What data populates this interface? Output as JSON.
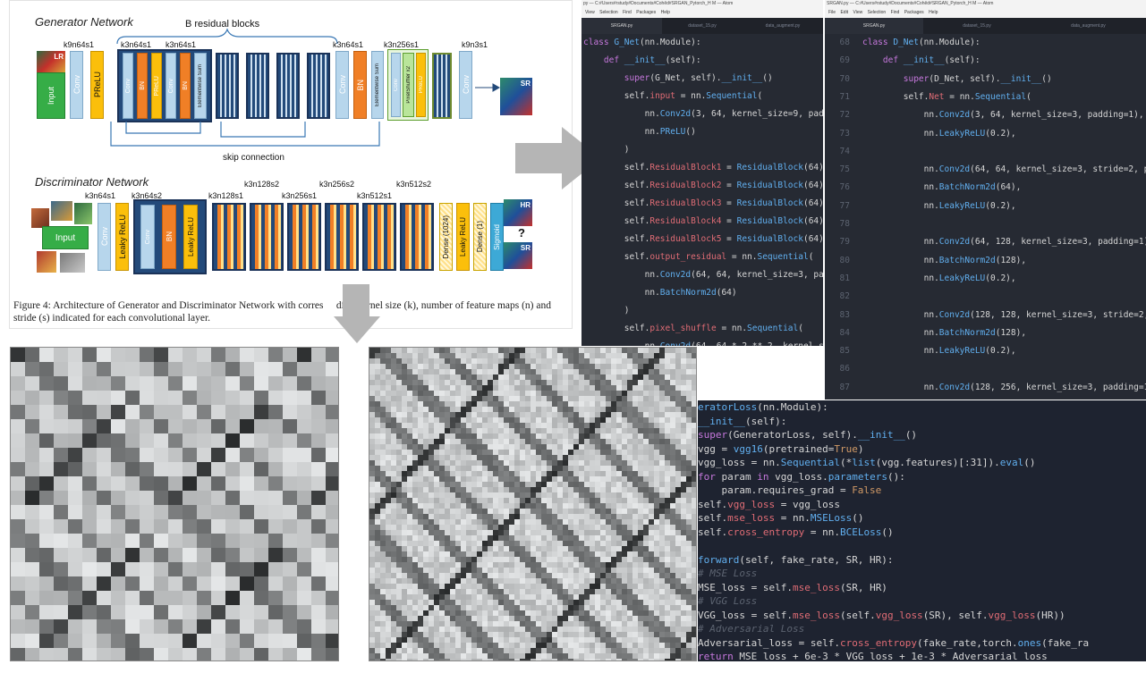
{
  "figure": {
    "generator_title": "Generator Network",
    "residual_blocks_label": "B residual blocks",
    "skip_label": "skip connection",
    "discriminator_title": "Discriminator Network",
    "gen_labels": [
      "k9n64s1",
      "k3n64s1",
      "k3n64s1",
      "k3n64s1",
      "k3n256s1",
      "k9n3s1"
    ],
    "gen_blocks": {
      "input": "Input",
      "lr": "LR",
      "conv": "Conv",
      "prelu": "PReLU",
      "bn": "BN",
      "elementwise_sum": "Elementwise Sum",
      "pixel_shuffler": "PixelShuffler x2",
      "sr": "SR"
    },
    "disc_labels": [
      "k3n64s1",
      "k3n64s2",
      "k3n128s1",
      "k3n128s2",
      "k3n256s1",
      "k3n256s2",
      "k3n512s1",
      "k3n512s2"
    ],
    "disc_blocks": {
      "input": "Input",
      "conv": "Conv",
      "leaky_relu": "Leaky ReLU",
      "bn": "BN",
      "dense1024": "Dense (1024)",
      "dense1": "Dense (1)",
      "sigmoid": "Sigmoid",
      "hr": "HR",
      "sr": "SR",
      "question": "?"
    },
    "caption": "Figure 4: Architecture of Generator and Discriminator Network with corres     ding kernel size (k), number of feature maps (n) and stride (s) indicated for each convolutional layer."
  },
  "editor_left": {
    "titlebar": "py — C:#Users#rstudy#Documents#Cohêd#SRGAN_Pytorch_H M — Atom",
    "menu": [
      "View",
      "Selection",
      "Find",
      "Packages",
      "Help"
    ],
    "tabs": [
      "SRGAN.py",
      "dataset_15.py",
      "data_augment.py"
    ],
    "lines": [
      {
        "n": "",
        "text": "class G_Net(nn.Module):"
      },
      {
        "n": "",
        "text": "    def __init__(self):"
      },
      {
        "n": "",
        "text": "        super(G_Net, self).__init__()"
      },
      {
        "n": "",
        "text": "        self.input = nn.Sequential("
      },
      {
        "n": "",
        "text": "            nn.Conv2d(3, 64, kernel_size=9, padding=4),"
      },
      {
        "n": "",
        "text": "            nn.PReLU()"
      },
      {
        "n": "",
        "text": "        )"
      },
      {
        "n": "",
        "text": "        self.ResidualBlock1 = ResidualBlock(64)"
      },
      {
        "n": "",
        "text": "        self.ResidualBlock2 = ResidualBlock(64)"
      },
      {
        "n": "",
        "text": "        self.ResidualBlock3 = ResidualBlock(64)"
      },
      {
        "n": "",
        "text": "        self.ResidualBlock4 = ResidualBlock(64)"
      },
      {
        "n": "",
        "text": "        self.ResidualBlock5 = ResidualBlock(64)"
      },
      {
        "n": "",
        "text": "        self.output_residual = nn.Sequential("
      },
      {
        "n": "",
        "text": "            nn.Conv2d(64, 64, kernel_size=3, padding=1),"
      },
      {
        "n": "",
        "text": "            nn.BatchNorm2d(64)"
      },
      {
        "n": "",
        "text": "        )"
      },
      {
        "n": "",
        "text": "        self.pixel_shuffle = nn.Sequential("
      },
      {
        "n": "",
        "text": "            nn.Conv2d(64, 64 * 2 ** 2, kernel_size=3, pad"
      },
      {
        "n": "",
        "text": "            (2),"
      }
    ]
  },
  "editor_right": {
    "titlebar": "SRGAN.py — C:#Users#rstudy#Documents#Cohêd#SRGAN_Pytorch_H M — Atom",
    "menu": [
      "File",
      "Edit",
      "View",
      "Selection",
      "Find",
      "Packages",
      "Help"
    ],
    "tabs": [
      "SRGAN.py",
      "dataset_15.py",
      "data_augment.py"
    ],
    "lines": [
      {
        "n": "68",
        "text": "class D_Net(nn.Module):"
      },
      {
        "n": "69",
        "text": "    def __init__(self):"
      },
      {
        "n": "70",
        "text": "        super(D_Net, self).__init__()"
      },
      {
        "n": "71",
        "text": "        self.Net = nn.Sequential("
      },
      {
        "n": "72",
        "text": "            nn.Conv2d(3, 64, kernel_size=3, padding=1),"
      },
      {
        "n": "73",
        "text": "            nn.LeakyReLU(0.2),"
      },
      {
        "n": "74",
        "text": ""
      },
      {
        "n": "75",
        "text": "            nn.Conv2d(64, 64, kernel_size=3, stride=2, padding=1),"
      },
      {
        "n": "76",
        "text": "            nn.BatchNorm2d(64),"
      },
      {
        "n": "77",
        "text": "            nn.LeakyReLU(0.2),"
      },
      {
        "n": "78",
        "text": ""
      },
      {
        "n": "79",
        "text": "            nn.Conv2d(64, 128, kernel_size=3, padding=1),"
      },
      {
        "n": "80",
        "text": "            nn.BatchNorm2d(128),"
      },
      {
        "n": "81",
        "text": "            nn.LeakyReLU(0.2),"
      },
      {
        "n": "82",
        "text": ""
      },
      {
        "n": "83",
        "text": "            nn.Conv2d(128, 128, kernel_size=3, stride=2, padding=1),"
      },
      {
        "n": "84",
        "text": "            nn.BatchNorm2d(128),"
      },
      {
        "n": "85",
        "text": "            nn.LeakyReLU(0.2),"
      },
      {
        "n": "86",
        "text": ""
      },
      {
        "n": "87",
        "text": "            nn.Conv2d(128, 256, kernel_size=3, padding=1),"
      }
    ]
  },
  "loss_code": {
    "lines": [
      "eratorLoss(nn.Module):",
      "__init__(self):",
      "super(GeneratorLoss, self).__init__()",
      "vgg = vgg16(pretrained=True)",
      "vgg_loss = nn.Sequential(*list(vgg.features)[:31]).eval()",
      "for param in vgg_loss.parameters():",
      "    param.requires_grad = False",
      "self.vgg_loss = vgg_loss",
      "self.mse_loss = nn.MSELoss()",
      "self.cross_entropy = nn.BCELoss()",
      "",
      "forward(self, fake_rate, SR, HR):",
      "# MSE Loss",
      "MSE_loss = self.mse_loss(SR, HR)",
      "# VGG Loss",
      "VGG_loss = self.mse_loss(self.vgg_loss(SR), self.vgg_loss(HR))",
      "# Adversarial Loss",
      "Adversarial_loss = self.cross_entropy(fake_rate,torch.ones(fake_ra",
      "return MSE_loss + 6e-3 * VGG_loss + 1e-3 * Adversarial_loss"
    ]
  },
  "colors": {
    "editor_bg": "#262a33",
    "keyword": "#c678dd",
    "function": "#61afef",
    "string": "#98c379",
    "attr": "#e06c75",
    "comment": "#5c6370",
    "number": "#d19a66"
  }
}
